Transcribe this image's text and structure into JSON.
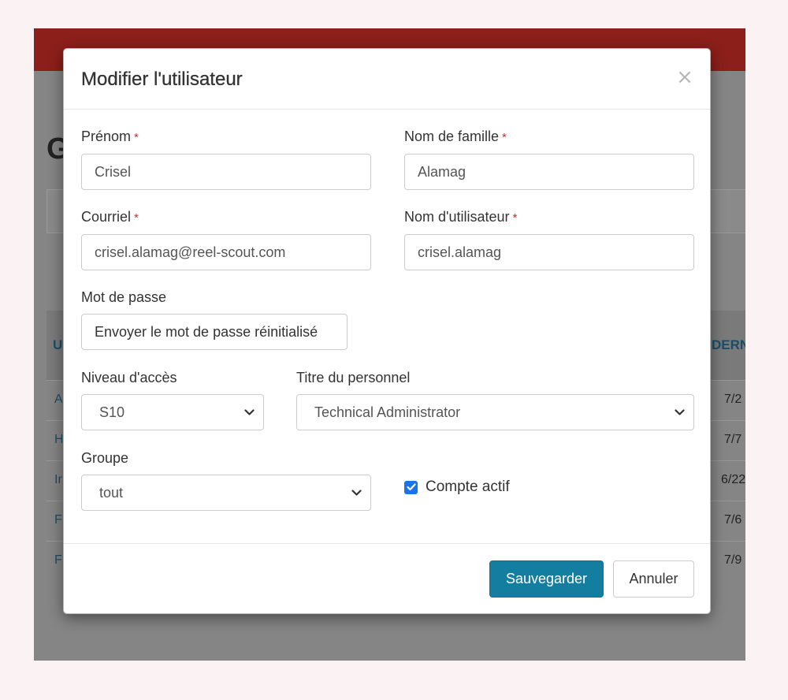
{
  "background": {
    "title_fragment": "G",
    "table_header_left": "U",
    "table_header_right": "DERN",
    "rows": [
      {
        "left": "A",
        "right": "7/2"
      },
      {
        "left": "H",
        "right": "7/7"
      },
      {
        "left": "Ir",
        "right": "6/22"
      },
      {
        "left": "F",
        "right": "7/6"
      },
      {
        "left": "F",
        "right": "7/9"
      }
    ]
  },
  "modal": {
    "title": "Modifier l'utilisateur",
    "close_symbol": "×",
    "required_marker": "*",
    "fields": {
      "first_name": {
        "label": "Prénom",
        "value": "Crisel"
      },
      "last_name": {
        "label": "Nom de famille",
        "value": "Alamag"
      },
      "email": {
        "label": "Courriel",
        "value": "crisel.alamag@reel-scout.com"
      },
      "username": {
        "label": "Nom d'utilisateur",
        "value": "crisel.alamag"
      },
      "password": {
        "label": "Mot de passe",
        "button_label": "Envoyer le mot de passe réinitialisé"
      },
      "access_level": {
        "label": "Niveau d'accès",
        "value": "S10"
      },
      "staff_title": {
        "label": "Titre du personnel",
        "value": "Technical Administrator"
      },
      "group": {
        "label": "Groupe",
        "value": "tout"
      },
      "active_account": {
        "label": "Compte actif",
        "checked": true
      }
    },
    "footer": {
      "save_label": "Sauvegarder",
      "cancel_label": "Annuler"
    }
  },
  "colors": {
    "primary": "#137ea0",
    "required": "#c9302c",
    "checkbox": "#1a73e8",
    "header_bar": "#8c1f1a"
  },
  "icons": {
    "close": "close-icon",
    "select_chevron": "chevron-down-icon",
    "checkbox": "checkmark-icon"
  }
}
